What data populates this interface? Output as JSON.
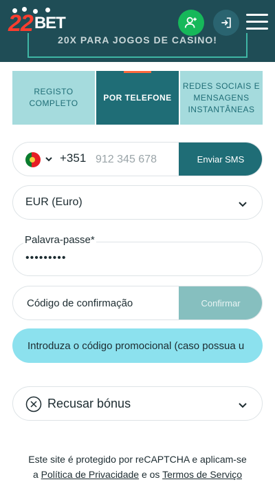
{
  "header": {
    "logo_num": "22",
    "logo_text": "BET",
    "promo_banner_text": "20X PARA JOGOS DE CASINO!"
  },
  "tabs": [
    {
      "label": "REGISTO COMPLETO",
      "active": false
    },
    {
      "label": "POR TELEFONE",
      "active": true
    },
    {
      "label": "REDES SOCIAIS E MENSAGENS INSTANTÂNEAS",
      "active": false
    }
  ],
  "phone": {
    "dial_code": "+351",
    "placeholder": "912 345 678",
    "send_sms_label": "Enviar SMS"
  },
  "currency": {
    "selected": "EUR (Euro)"
  },
  "password": {
    "label": "Palavra-passe",
    "required_mark": "*",
    "masked_value": "•••••••••"
  },
  "confirmation": {
    "label": "Código de confirmação",
    "confirm_label": "Confirmar"
  },
  "promo_code": {
    "placeholder": "Introduza o código promocional (caso possua u"
  },
  "bonus": {
    "label": "Recusar bónus"
  },
  "recaptcha": {
    "line1": "Este site é protegido por reCAPTCHA e aplicam-se",
    "prefix": "a",
    "privacy_link": "Política de Privacidade",
    "conjunction": "e os",
    "terms_link": "Termos de Serviço"
  },
  "colors": {
    "header_bg": "#1f4d56",
    "tab_active": "#1f6d76",
    "tab_inactive": "#a5dbdd",
    "accent_green": "#16b85a",
    "promo_field": "#8ce1ee"
  }
}
